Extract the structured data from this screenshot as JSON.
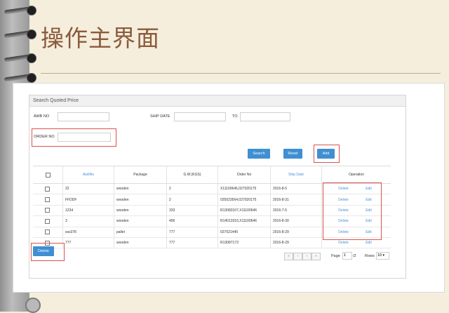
{
  "slide": {
    "title": "操作主界面"
  },
  "panel": {
    "header": "Search Quoted Price",
    "filters": {
      "awb_label": "AWB NO",
      "awb_sep": ":",
      "ship_date_label": "SHIP DATE",
      "to_label": "TO",
      "order_label": "ORDER NO"
    },
    "buttons": {
      "search": "Search",
      "reset": "Reset",
      "add": "Add",
      "delete": "Delete"
    },
    "table": {
      "columns": [
        "",
        "AwbNo",
        "Package",
        "G.W.(KGS)",
        "Order No",
        "Ship Date",
        "Operation"
      ],
      "rows": [
        {
          "awb": "22",
          "package": "wooden",
          "gw": "2",
          "order": "X11100646,027020175",
          "date": "2016-8-5",
          "op1": "Delete",
          "op2": "Edit"
        },
        {
          "awb": "FFDDF",
          "package": "wooden",
          "gw": "2",
          "order": "025023564,027020175",
          "date": "2016-8-31",
          "op1": "Delete",
          "op2": "Edit"
        },
        {
          "awb": "1234",
          "package": "wooden",
          "gw": "333",
          "order": "R13083107,X11100646",
          "date": "2016-7-5",
          "op1": "Delete",
          "op2": "Edit"
        },
        {
          "awb": "3",
          "package": "wooden",
          "gw": "456",
          "order": "R14013316,X11100646",
          "date": "2016-8-30",
          "op1": "Delete",
          "op2": "Edit"
        },
        {
          "awb": "sss378",
          "package": "pallet",
          "gw": "777",
          "order": "027021440",
          "date": "2016-8-29",
          "op1": "Delete",
          "op2": "Edit"
        },
        {
          "awb": "777",
          "package": "wooden",
          "gw": "777",
          "order": "R13087173",
          "date": "2016-8-29",
          "op1": "Delete",
          "op2": "Edit"
        }
      ]
    },
    "pager": {
      "page_label": "Page",
      "page_value": "1",
      "of_label": "/2",
      "rows_label": "Rows",
      "rows_value": "10"
    }
  },
  "colors": {
    "accent": "#3f8fd2",
    "highlight": "#d9534f",
    "title": "#8b5a3c"
  }
}
